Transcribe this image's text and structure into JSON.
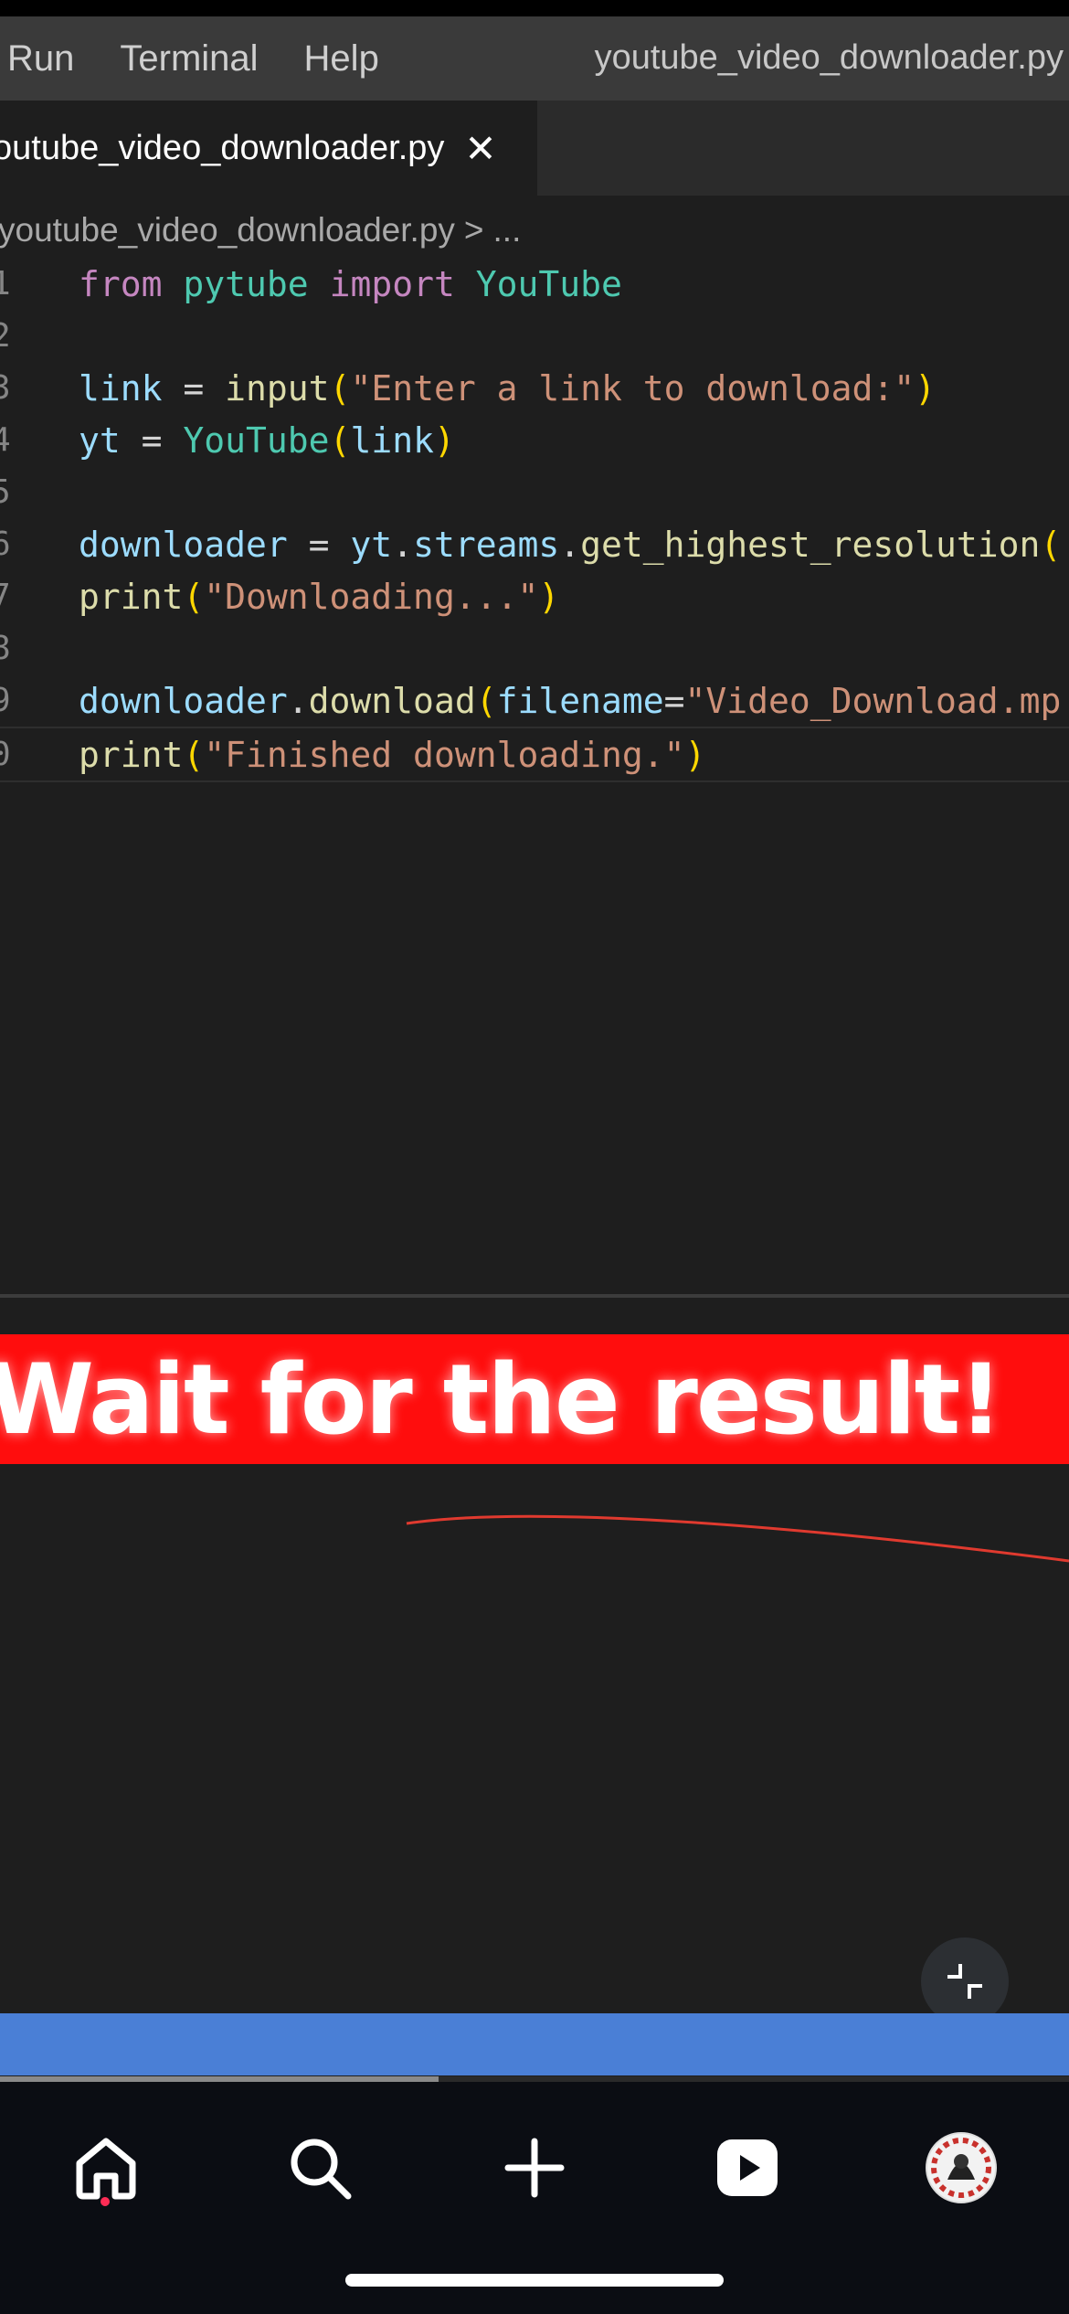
{
  "menubar": {
    "items": [
      "Run",
      "Terminal",
      "Help"
    ],
    "window_title": "youtube_video_downloader.py"
  },
  "tab": {
    "label": "outube_video_downloader.py",
    "close_glyph": "✕"
  },
  "breadcrumb": {
    "file": "youtube_video_downloader.py",
    "separator": ">",
    "more": "..."
  },
  "editor": {
    "line_numbers": [
      "1",
      "2",
      "3",
      "4",
      "5",
      "6",
      "7",
      "8",
      "9",
      "0"
    ],
    "lines": [
      [
        {
          "t": "from",
          "c": "kw"
        },
        {
          "t": " "
        },
        {
          "t": "pytube",
          "c": "mod"
        },
        {
          "t": " "
        },
        {
          "t": "import",
          "c": "kw"
        },
        {
          "t": " "
        },
        {
          "t": "YouTube",
          "c": "mod"
        }
      ],
      [],
      [
        {
          "t": "link",
          "c": "var"
        },
        {
          "t": " = "
        },
        {
          "t": "input",
          "c": "fn"
        },
        {
          "t": "(",
          "c": "par"
        },
        {
          "t": "\"Enter a link to download:\"",
          "c": "str"
        },
        {
          "t": ")",
          "c": "par"
        }
      ],
      [
        {
          "t": "yt",
          "c": "var"
        },
        {
          "t": " = "
        },
        {
          "t": "YouTube",
          "c": "mod"
        },
        {
          "t": "(",
          "c": "par"
        },
        {
          "t": "link",
          "c": "var"
        },
        {
          "t": ")",
          "c": "par"
        }
      ],
      [],
      [
        {
          "t": "downloader",
          "c": "var"
        },
        {
          "t": " = "
        },
        {
          "t": "yt",
          "c": "var"
        },
        {
          "t": "."
        },
        {
          "t": "streams",
          "c": "var"
        },
        {
          "t": "."
        },
        {
          "t": "get_highest_resolution",
          "c": "fn"
        },
        {
          "t": "(",
          "c": "par"
        }
      ],
      [
        {
          "t": "print",
          "c": "fn"
        },
        {
          "t": "(",
          "c": "par"
        },
        {
          "t": "\"Downloading...\"",
          "c": "str"
        },
        {
          "t": ")",
          "c": "par"
        }
      ],
      [],
      [
        {
          "t": "downloader",
          "c": "var"
        },
        {
          "t": "."
        },
        {
          "t": "download",
          "c": "fn"
        },
        {
          "t": "(",
          "c": "par"
        },
        {
          "t": "filename",
          "c": "var"
        },
        {
          "t": "="
        },
        {
          "t": "\"Video_Download.mp",
          "c": "str"
        }
      ],
      [
        {
          "t": "print",
          "c": "fn"
        },
        {
          "t": "(",
          "c": "par"
        },
        {
          "t": "\"Finished downloading.\"",
          "c": "str"
        },
        {
          "t": ")",
          "c": "par"
        }
      ]
    ],
    "current_line_index": 9
  },
  "banner": {
    "text": "Wait for the result!"
  },
  "video": {
    "progress_fraction": 0.41
  },
  "bottom_nav": {
    "items": [
      "home-icon",
      "search-icon",
      "create-icon",
      "inbox-play-icon",
      "profile-avatar"
    ],
    "active": "home-icon"
  },
  "colors": {
    "editor_bg": "#1e1e1e",
    "menubar_bg": "#3a3a3a",
    "banner_bg": "#ff0d0d",
    "accent_blue": "#4a7fd6",
    "nav_bg": "#0b0d13",
    "active_dot": "#fe2c55"
  }
}
